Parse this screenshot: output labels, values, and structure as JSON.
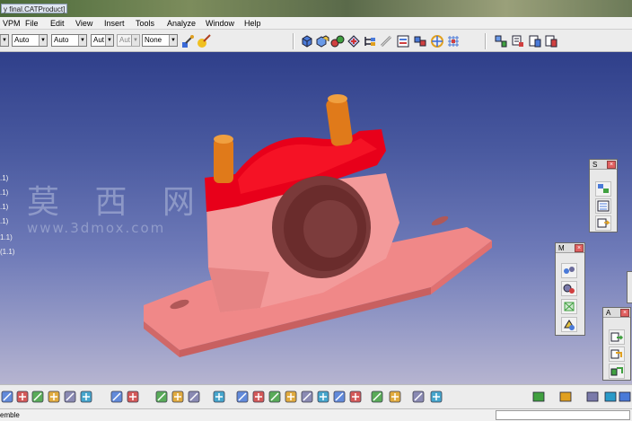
{
  "window": {
    "title_fragment": "y final.CATProduct]"
  },
  "menu": {
    "items": [
      "VPM",
      "File",
      "Edit",
      "View",
      "Insert",
      "Tools",
      "Analyze",
      "Window",
      "Help"
    ]
  },
  "graphic_properties_toolbar": {
    "combos": [
      {
        "value": ""
      },
      {
        "value": "Auto"
      },
      {
        "value": "Auto"
      },
      {
        "value": "Aut"
      },
      {
        "value": "Aut",
        "disabled": true
      },
      {
        "value": "None"
      }
    ],
    "icons": [
      "painter-icon",
      "color-brush-icon"
    ]
  },
  "top_toolbar_icons": [
    "component-icon",
    "product-icon",
    "existing-component-icon",
    "replace-component-icon",
    "graph-tree-icon",
    "generate-numbering-icon",
    "reorder-icon",
    "multi-instantiation-icon",
    "manipulate-icon",
    "snap-icon",
    "explode-icon",
    "clash-icon"
  ],
  "spec_tree": {
    "nodes": [
      ".1)",
      ".1)",
      ".1)",
      ".1)",
      "1.1)",
      "(1.1)"
    ]
  },
  "watermark": {
    "cn": "莫 西 网",
    "url": "www.3dmox.com"
  },
  "palettes": [
    {
      "label": "S",
      "icons": [
        "catalog-icon",
        "parts-list-icon",
        "scene-icon"
      ]
    },
    {
      "label": "M",
      "icons": [
        "constraint-icon",
        "fix-icon",
        "contact-icon",
        "offset-icon"
      ]
    },
    {
      "label": "A",
      "icons": [
        "update-icon",
        "save-management-icon",
        "constraint-update-icon"
      ]
    }
  ],
  "bottom_toolbar_icons": [
    "cut-icon",
    "copy-icon",
    "paste-icon",
    "undo-icon",
    "redo-icon",
    "whats-this-icon",
    "formula-icon",
    "balloon-icon",
    "table-icon",
    "hierarchy-icon",
    "fit-all-icon",
    "pan-icon",
    "rotate-icon",
    "zoom-in-icon",
    "zoom-out-icon",
    "normal-view-icon",
    "iso-view-icon",
    "shading-icon",
    "hide-show-icon",
    "swap-visible-icon",
    "measure-icon",
    "sectioning-icon",
    "camera-icon",
    "capture-icon"
  ],
  "status_bar": {
    "text": "emble"
  },
  "colors": {
    "viewport_top": "#2f3f8a",
    "viewport_bottom": "#b6b4d0",
    "housing_cap": "#e8001a",
    "housing_base": "#f08a8a",
    "bushing": "#7a3838",
    "pins": "#e07a1a"
  }
}
